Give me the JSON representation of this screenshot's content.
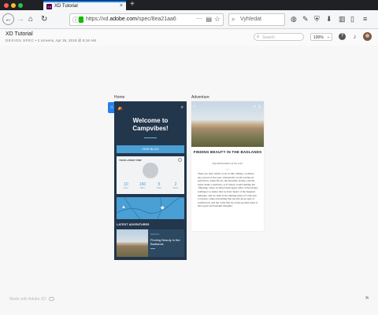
{
  "browser": {
    "tab_title": "XD Tutorial",
    "tab_favicon": "Xd",
    "tab_close": "×",
    "new_tab": "+",
    "url_host": "https://xd.",
    "url_domain": "adobe.com",
    "url_path": "/spec/8ea21aa6",
    "url_dots": "···",
    "search_placeholder": "Vyhledat",
    "back_icon": "←",
    "forward_icon": "→",
    "home_icon": "⌂",
    "reload_icon": "↻"
  },
  "app": {
    "doc_title": "XD Tutorial",
    "doc_tag": "DESIGN SPEC",
    "doc_meta": " • 2 screens, Apr 26, 2019 @ 8:18 AM",
    "search_placeholder": "Search",
    "zoom": "100%"
  },
  "artboards": {
    "home_label": "Home",
    "adventure_label": "Adventure"
  },
  "home": {
    "welcome": "Welcome to Campvibes!",
    "our_blog": "OUR BLOG",
    "card_title": "YOUR LATEST TRIP",
    "stats": [
      {
        "value": "10",
        "label": "Days"
      },
      {
        "value": "160",
        "label": "Miles"
      },
      {
        "value": "5",
        "label": "Parks"
      },
      {
        "value": "2",
        "label": "Bears"
      }
    ],
    "latest_label": "LATEST ADVENTURES",
    "latest_small": "Adventure",
    "latest_title": "Finding Beauty in the Badlands"
  },
  "adventure": {
    "title": "FINDING BEAUTY IN THE BADLANDS",
    "subtitle": "Top destinations of the year",
    "body": "There are days which occur in this climate, at almost any season of the year, wherein the world reaches its perfection, when the air, the heavenly bodies, and the earth, make a harmony, as if nature would indulge her offspring; when, in these bleak upper sides of the planet, nothing is to desire that we have heard of the happiest latitudes, and we bask in the shining hours of Utah and Colorado; when everything that has life gives sign of satisfaction, and the cattle that lie on the ground seem to have great and tranquil thoughts."
  },
  "footer": {
    "made_with": "Made with Adobe XD"
  }
}
